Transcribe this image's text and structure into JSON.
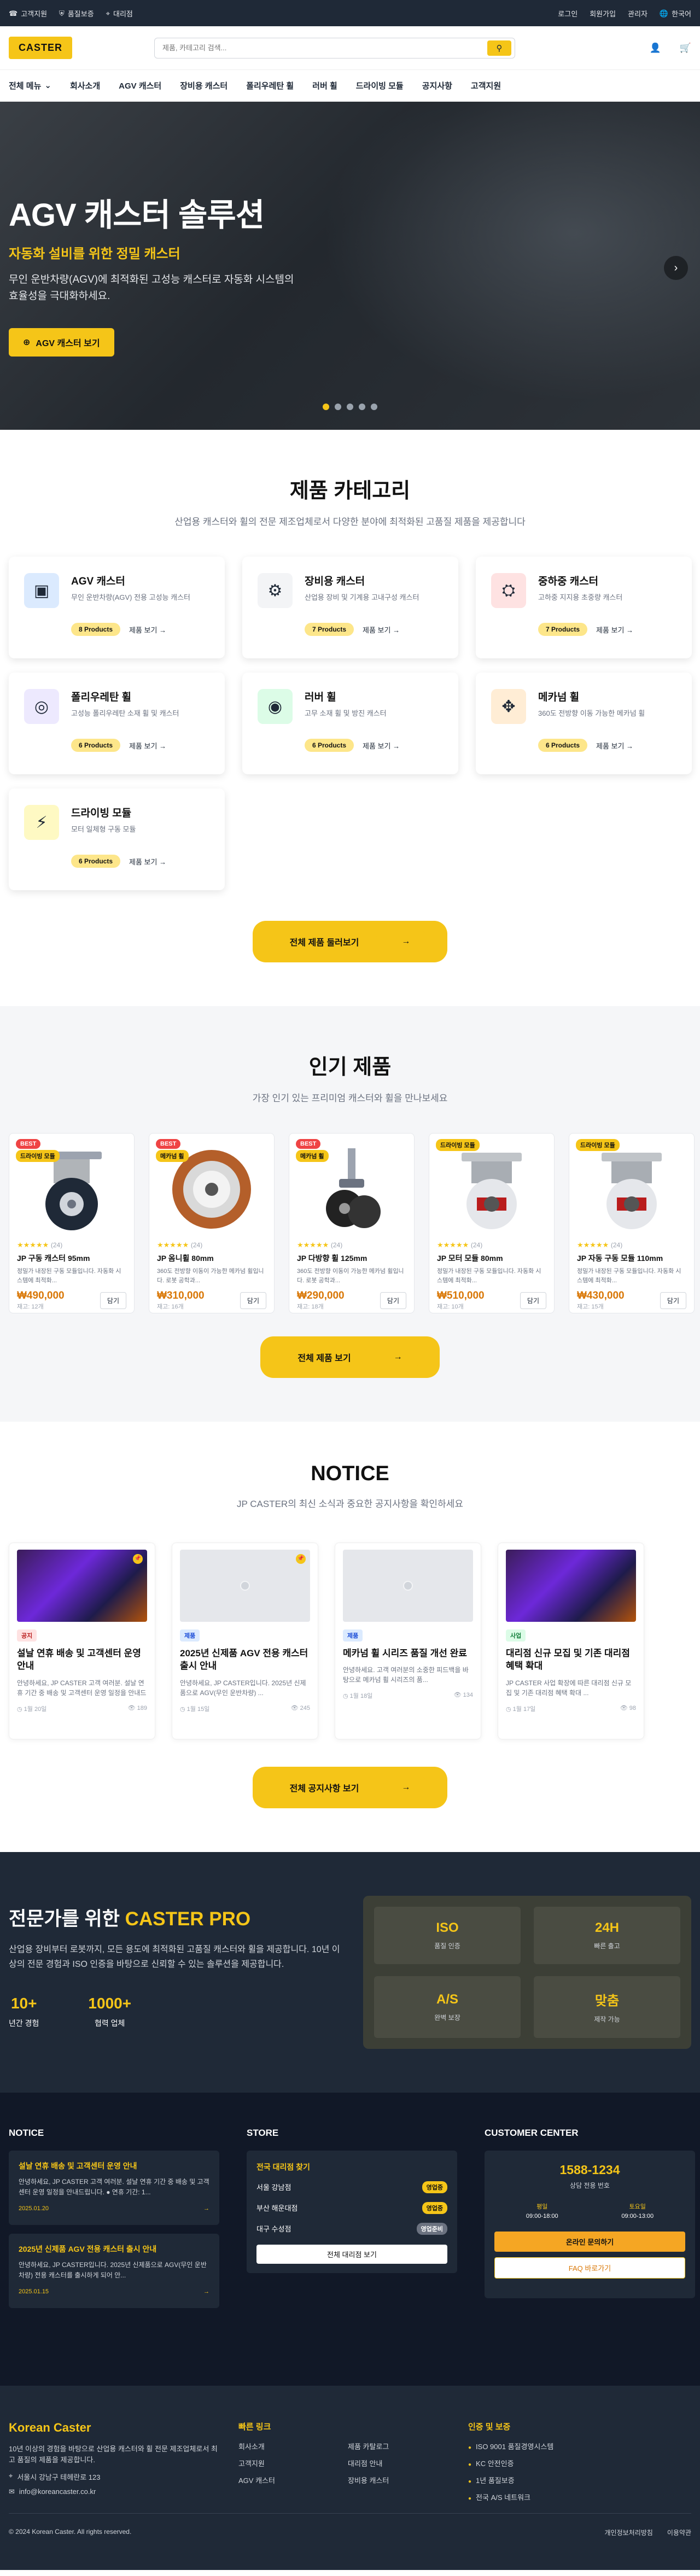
{
  "topbar": {
    "left": [
      {
        "icon": "phone-icon",
        "label": "고객지원"
      },
      {
        "icon": "shield-icon",
        "label": "품질보증"
      },
      {
        "icon": "location-icon",
        "label": "대리점"
      }
    ],
    "right": [
      "로그인",
      "회원가입",
      "관리자"
    ],
    "language": "한국어"
  },
  "header": {
    "logo": "CASTER",
    "search_placeholder": "제품, 카테고리 검색..."
  },
  "nav": {
    "all_menu": "전체 메뉴",
    "items": [
      "회사소개",
      "AGV 캐스터",
      "장비용 캐스터",
      "폴리우레탄 휠",
      "러버 휠",
      "드라이빙 모듈",
      "공지사항",
      "고객지원"
    ]
  },
  "hero": {
    "title": "AGV 캐스터 솔루션",
    "subtitle": "자동화 설비를 위한 정밀 캐스터",
    "description": "무인 운반차량(AGV)에 최적화된 고성능 캐스터로 자동화 시스템의 효율성을 극대화하세요.",
    "cta": "AGV 캐스터 보기",
    "active_slide": 1,
    "slide_count": 5
  },
  "categories": {
    "title": "제품 카테고리",
    "subtitle": "산업용 캐스터와 휠의 전문 제조업체로서 다양한 분야에 최적화된 고품질 제품을 제공합니다",
    "view_link": "제품 보기",
    "items": [
      {
        "name": "AGV 캐스터",
        "desc": "무인 운반차량(AGV) 전용 고성능 캐스터",
        "count": "8 Products",
        "color": "#dbeafe"
      },
      {
        "name": "장비용 캐스터",
        "desc": "산업용 장비 및 기계용 고내구성 캐스터",
        "count": "7 Products",
        "color": "#f3f4f6"
      },
      {
        "name": "중하중 캐스터",
        "desc": "고하중 지지용 초중량 캐스터",
        "count": "7 Products",
        "color": "#fee2e2"
      },
      {
        "name": "폴리우레탄 휠",
        "desc": "고성능 폴리우레탄 소재 휠 및 캐스터",
        "count": "6 Products",
        "color": "#ede9fe"
      },
      {
        "name": "러버 휠",
        "desc": "고무 소재 휠 및 방진 캐스터",
        "count": "6 Products",
        "color": "#dcfce7"
      },
      {
        "name": "메카넘 휠",
        "desc": "360도 전방향 이동 가능한 메카넘 휠",
        "count": "6 Products",
        "color": "#ffedd5"
      },
      {
        "name": "드라이빙 모듈",
        "desc": "모터 일체형 구동 모듈",
        "count": "6 Products",
        "color": "#fef9c3"
      }
    ],
    "all_button": "전체 제품 둘러보기"
  },
  "products": {
    "title": "인기 제품",
    "subtitle": "가장 인기 있는 프리미엄 캐스터와 휠을 만나보세요",
    "add_label": "담기",
    "items": [
      {
        "best": "BEST",
        "tag": "드라이빙 모듈",
        "reviews": "(24)",
        "name": "JP 구동 캐스터 95mm",
        "desc": "정밀가 내장된 구동 모듈입니다. 자동화 시스템에 최적화...",
        "price": "₩490,000",
        "stock": "재고: 12개",
        "type": "caster-black"
      },
      {
        "best": "BEST",
        "tag": "메카넘 휠",
        "reviews": "(24)",
        "name": "JP 옴니휠 80mm",
        "desc": "360도 전방향 이동이 가능한 메카넘 휠입니다. 로봇 공학과...",
        "price": "₩310,000",
        "stock": "재고: 16개",
        "type": "wheel-orange"
      },
      {
        "best": "BEST",
        "tag": "메카넘 휠",
        "reviews": "(24)",
        "name": "JP 다방향 휠 125mm",
        "desc": "360도 전방향 이동이 가능한 메카넘 휠입니다. 로봇 공학과...",
        "price": "₩290,000",
        "stock": "재고: 18개",
        "type": "caster-stem"
      },
      {
        "best": "",
        "tag": "드라이빙 모듈",
        "reviews": "(24)",
        "name": "JP 모터 모듈 80mm",
        "desc": "정밀가 내장된 구동 모듈입니다. 자동화 시스템에 최적화...",
        "price": "₩510,000",
        "stock": "재고: 10개",
        "type": "caster-red"
      },
      {
        "best": "",
        "tag": "드라이빙 모듈",
        "reviews": "(24)",
        "name": "JP 자동 구동 모듈 110mm",
        "desc": "정밀가 내장된 구동 모듈입니다. 자동화 시스템에 최적화...",
        "price": "₩430,000",
        "stock": "재고: 15개",
        "type": "caster-red"
      }
    ],
    "all_button": "전체 제품 보기"
  },
  "notice": {
    "title": "NOTICE",
    "subtitle": "JP CASTER의 최신 소식과 중요한 공지사항을 확인하세요",
    "items": [
      {
        "type": "공지",
        "type_color": "#fee2e2",
        "type_text": "#b91c1c",
        "title": "설날 연휴 배송 및 고객센터 운영 안내",
        "desc": "안녕하세요, JP CASTER 고객 여러분. 설날 연휴 기간 중 배송 및 고객센터 운영 일정을 안내드립니다. ● 연휴 ...",
        "date": "1월 20일",
        "views": "189",
        "image": "photo",
        "pinned": true
      },
      {
        "type": "제품",
        "type_color": "#dbeafe",
        "type_text": "#1d4ed8",
        "title": "2025년 신제품 AGV 전용 캐스터 출시 안내",
        "desc": "안녕하세요, JP CASTER입니다. 2025년 신제품으로 AGV(무인 운반차량) ...",
        "date": "1월 15일",
        "views": "245",
        "image": "placeholder",
        "pinned": true
      },
      {
        "type": "제품",
        "type_color": "#dbeafe",
        "type_text": "#1d4ed8",
        "title": "메카넘 휠 시리즈 품질 개선 완료",
        "desc": "안녕하세요. 고객 여러분의 소중한 피드백을 바탕으로 메카넘 휠 시리즈의 품...",
        "date": "1월 18일",
        "views": "134",
        "image": "placeholder",
        "pinned": false
      },
      {
        "type": "사업",
        "type_color": "#dcfce7",
        "type_text": "#15803d",
        "title": "대리점 신규 모집 및 기존 대리점 혜택 확대",
        "desc": "JP CASTER 사업 확장에 따른 대리점 신규 모집 및 기존 대리점 혜택 확대 ...",
        "date": "1월 17일",
        "views": "98",
        "image": "photo",
        "pinned": false
      }
    ],
    "all_button": "전체 공지사항 보기"
  },
  "pro": {
    "title_plain": "전문가를 위한",
    "title_accent": "CASTER PRO",
    "desc": "산업용 장비부터 로봇까지, 모든 용도에 최적화된 고품질 캐스터와 휠을 제공합니다. 10년 이상의 전문 경험과 ISO 인증을 바탕으로 신뢰할 수 있는 솔루션을 제공합니다.",
    "stats": [
      {
        "value": "10+",
        "label": "년간 경험"
      },
      {
        "value": "1000+",
        "label": "협력 업체"
      }
    ],
    "features": [
      {
        "value": "ISO",
        "label": "품질 인증"
      },
      {
        "value": "24H",
        "label": "빠른 출고"
      },
      {
        "value": "A/S",
        "label": "완벽 보장"
      },
      {
        "value": "맞춤",
        "label": "제작 가능"
      }
    ]
  },
  "footer_top": {
    "notice_title": "NOTICE",
    "notice_items": [
      {
        "title": "설날 연휴 배송 및 고객센터 운영 안내",
        "desc": "안녕하세요, JP CASTER 고객 여러분. 설날 연휴 기간 중 배송 및 고객센터 운영 일정을 안내드립니다. ● 연휴 기간: 1...",
        "date": "2025.01.20"
      },
      {
        "title": "2025년 신제품 AGV 전용 캐스터 출시 안내",
        "desc": "안녕하세요, JP CASTER입니다. 2025년 신제품으로 AGV(무인 운반차량) 전용 캐스터를 출시하게 되어 안...",
        "date": "2025.01.15"
      }
    ],
    "store_title": "STORE",
    "store_heading": "전국 대리점 찾기",
    "stores": [
      {
        "name": "서울 강남점",
        "status": "영업중",
        "color": "#f5c518",
        "text": "#111"
      },
      {
        "name": "부산 해운대점",
        "status": "영업중",
        "color": "#f5c518",
        "text": "#111"
      },
      {
        "name": "대구 수성점",
        "status": "영업준비",
        "color": "#6b7280",
        "text": "#fff"
      }
    ],
    "store_button": "전체 대리점 보기",
    "cc_title": "CUSTOMER CENTER",
    "phone": "1588-1234",
    "phone_sub": "상담 전용 번호",
    "hours": [
      {
        "label": "평일",
        "time": "09:00-18:00"
      },
      {
        "label": "토요일",
        "time": "09:00-13:00"
      }
    ],
    "cc_btn1": "온라인 문의하기",
    "cc_btn2": "FAQ 바로가기"
  },
  "footer": {
    "brand": "Korean Caster",
    "desc": "10년 이상의 경험을 바탕으로 산업용 캐스터와 휠 전문 제조업체로서 최고 품질의 제품을 제공합니다.",
    "address": "서울시 강남구 테헤란로 123",
    "email": "info@koreancaster.co.kr",
    "links_title": "빠른 링크",
    "links": [
      "회사소개",
      "제품 카탈로그",
      "고객지원",
      "대리점 안내",
      "AGV 캐스터",
      "장비용 캐스터"
    ],
    "cert_title": "인증 및 보증",
    "certs": [
      "ISO 9001 품질경영시스템",
      "KC 안전인증",
      "1년 품질보증",
      "전국 A/S 네트워크"
    ],
    "copyright": "© 2024 Korean Caster. All rights reserved.",
    "legal": [
      "개인정보처리방침",
      "이용약관"
    ]
  }
}
